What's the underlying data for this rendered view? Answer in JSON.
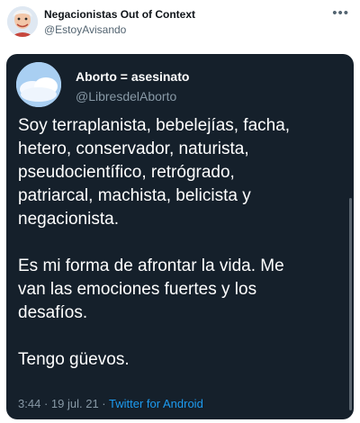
{
  "outer": {
    "name": "Negacionistas Out of Context",
    "handle": "@EstoyAvisando",
    "more_icon": "more-icon"
  },
  "quoted": {
    "name": "Aborto = asesinato",
    "handle": "@LibresdelAborto",
    "lines": [
      "Soy terraplanista, bebelejías, facha,",
      "hetero, conservador, naturista,",
      "pseudocientífico, retrógrado,",
      "patriarcal, machista, belicista y",
      "negacionista.",
      "",
      "Es mi forma de afrontar la vida. Me",
      "van las emociones fuertes y los",
      "desafíos.",
      "",
      "Tengo güevos."
    ],
    "time": "3:44",
    "sep": "·",
    "date": "19 jul. 21",
    "source": "Twitter for Android"
  },
  "colors": {
    "card_bg": "#15202b",
    "link": "#1d9bf0",
    "muted": "#8899a6"
  }
}
